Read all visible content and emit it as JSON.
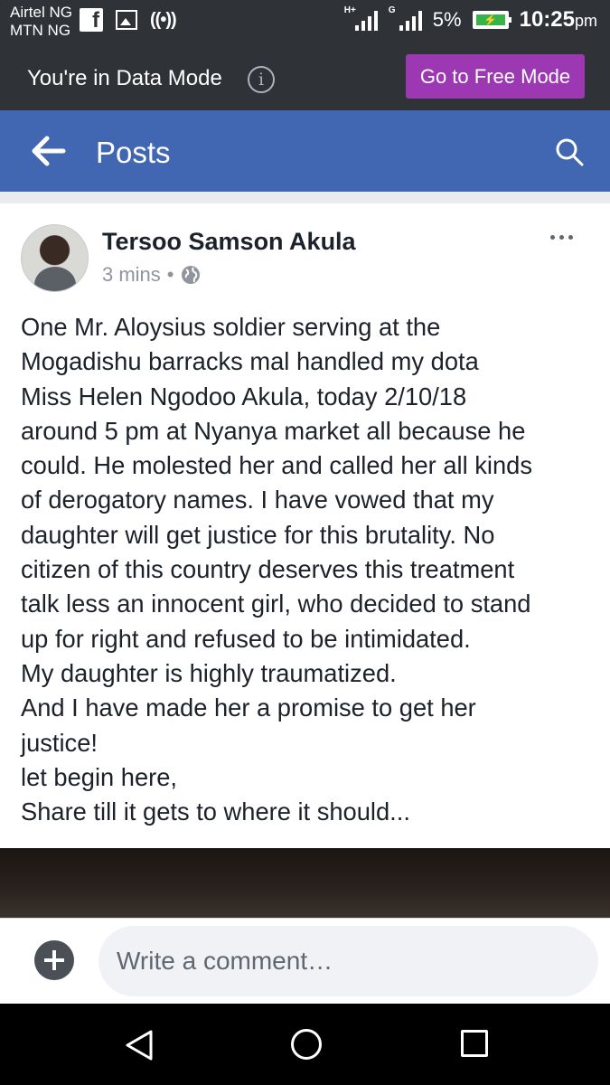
{
  "status_bar": {
    "carrier_1": "Airtel NG",
    "carrier_2": "MTN NG",
    "signal_1_tag": "H+",
    "signal_2_tag": "G",
    "battery": "5%",
    "time": "10:25",
    "time_suffix": "pm"
  },
  "data_mode_bar": {
    "message": "You're in Data Mode",
    "info_icon": "i",
    "button_label": "Go to Free Mode"
  },
  "header": {
    "title": "Posts"
  },
  "post": {
    "author": "Tersoo Samson Akula",
    "time": "3 mins",
    "separator": "•",
    "lines": [
      "One Mr. Aloysius  soldier serving at the",
      "Mogadishu barracks mal handled my dota",
      "Miss Helen Ngodoo Akula, today 2/10/18",
      "around 5 pm at Nyanya market all because he",
      "could. He molested  her and called her all kinds",
      "of derogatory names. I have vowed that my",
      "daughter will get justice for this brutality. No",
      "citizen of this country deserves this treatment",
      "talk less an innocent girl, who decided to stand",
      "up for right and refused to be intimidated.",
      "My daughter is highly traumatized.",
      "And I have made her a promise to get her",
      "justice!",
      "let begin here,",
      "Share till it gets to where it should..."
    ]
  },
  "comment_bar": {
    "placeholder": "Write a comment…"
  },
  "colors": {
    "status_bg": "#2f3237",
    "fb_blue": "#4267b2",
    "free_mode_purple": "#9c39b2",
    "text": "#1d2129",
    "meta_text": "#90949c"
  },
  "icons": {
    "status_bar": [
      "facebook-icon",
      "image-icon",
      "hotspot-icon",
      "signal-icon",
      "battery-icon"
    ],
    "header": [
      "back-arrow-icon",
      "search-icon"
    ],
    "post": [
      "globe-icon",
      "more-icon"
    ],
    "comment_bar": [
      "add-icon"
    ],
    "nav_bar": [
      "back-triangle-icon",
      "home-circle-icon",
      "recents-square-icon"
    ]
  }
}
